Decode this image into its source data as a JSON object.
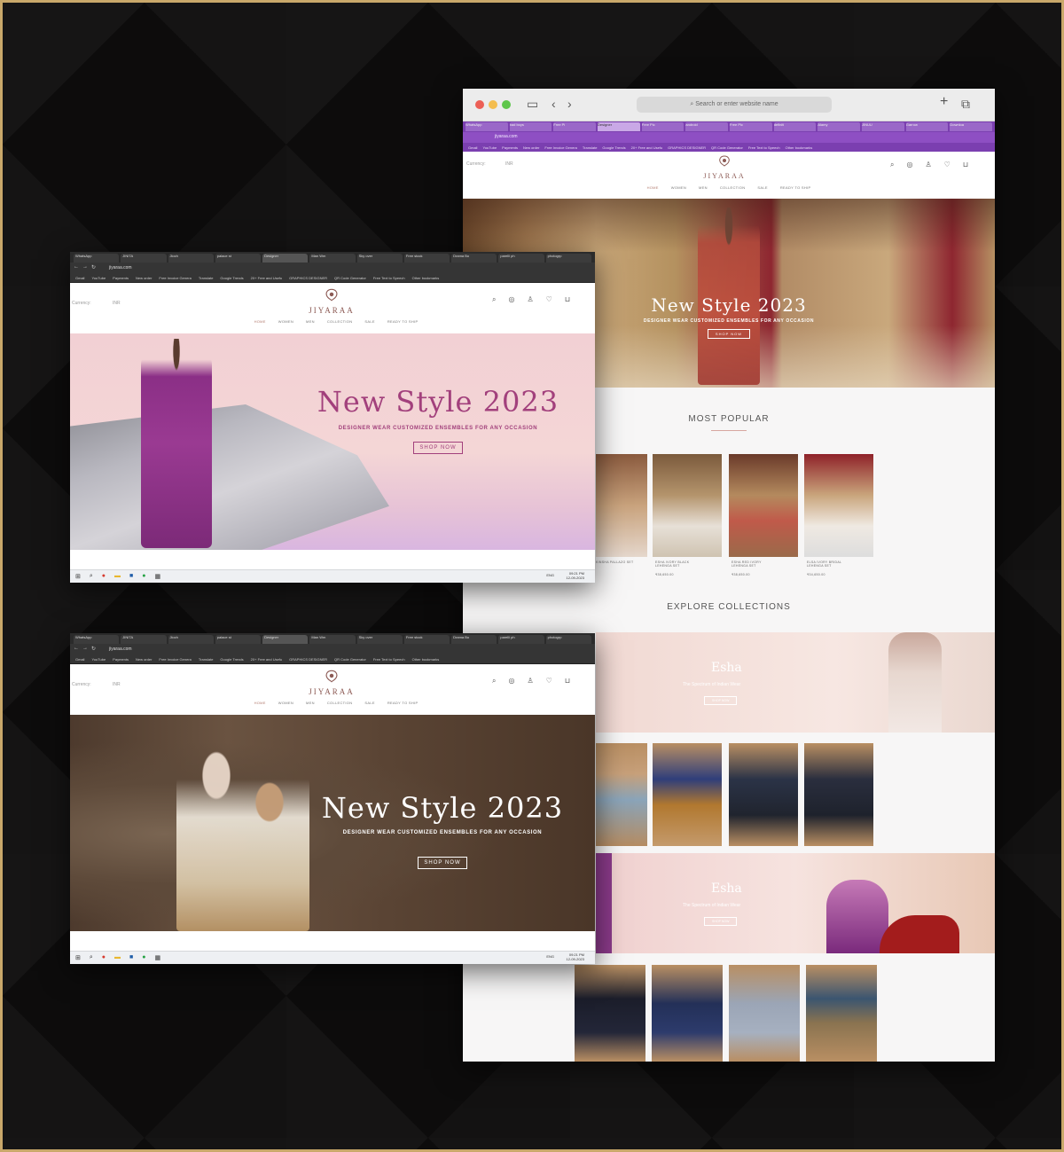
{
  "site": {
    "brand": "JIYARAA",
    "url": "jiyaraa.com",
    "currency_label": "Currency:",
    "currency_value": "INR",
    "nav": [
      "HOME",
      "WOMEN",
      "MEN",
      "COLLECTION",
      "SALE",
      "READY TO SHIP"
    ],
    "hero": {
      "title": "New Style 2023",
      "subtitle": "DESIGNER WEAR CUSTOMIZED ENSEMBLES FOR ANY OCCASION",
      "button": "SHOP NOW"
    },
    "sections": {
      "most_popular": "MOST POPULAR",
      "explore": "EXPLORE COLLECTIONS"
    },
    "products": [
      {
        "name": "KINSHA PALLAZO SET",
        "price": ""
      },
      {
        "name": "ESHA IVORY BLACK LEHENGA SET",
        "price": "₹38,650.00"
      },
      {
        "name": "ESHA RED IVORY LEHENGA SET",
        "price": "₹38,650.00"
      },
      {
        "name": "ELSA IVORY BRIDAL LEHENGA SET",
        "price": "₹34,650.00"
      }
    ],
    "collections": [
      {
        "title": "Esha",
        "subtitle": "The Spectrum of Indian Wear",
        "button": "SHOP NOW"
      },
      {
        "title": "Esha",
        "subtitle": "The Spectrum of Indian Wear",
        "button": "SHOP NOW"
      }
    ]
  },
  "mac_browser": {
    "search_placeholder": "Search or enter website name",
    "tabs": [
      "WhatsApp",
      "bad boys",
      "Free Pi",
      "Designer",
      "Free Pic",
      "android",
      "Free Pic",
      "definiti",
      "Alamy",
      "JINUU",
      "Garrow",
      "Downloa"
    ],
    "bookmarks": [
      "Gmail",
      "YouTube",
      "Payments",
      "New order",
      "Free Invoice Genera",
      "Translate",
      "Google Trends",
      "20+ Free and Usefu",
      "GRAPHICS DESIGNER",
      "QR Code Generator",
      "Free Text to Speech",
      "Other bookmarks"
    ]
  },
  "windows_browser_1": {
    "tabs": [
      "WhatsApp",
      "JINITA",
      "Jioch",
      "palace st",
      "Designer",
      "Man Wm",
      "Sky over",
      "Free stock",
      "Drama Bo",
      "parelli ph",
      "photogrp"
    ],
    "bookmarks": [
      "Gmail",
      "YouTube",
      "Payments",
      "New order",
      "Free Invoice Genera",
      "Translate",
      "Google Trends",
      "20+ Free and Usefu",
      "GRAPHICS DESIGNER",
      "QR Code Generator",
      "Free Text to Speech",
      "Other bookmarks"
    ],
    "clock_time": "09:21 PM",
    "clock_date": "12-09-2023",
    "lang": "ENG"
  },
  "windows_browser_2": {
    "tabs": [
      "WhatsApp",
      "JINITA",
      "Jioch",
      "palace st",
      "Designer",
      "Man Wm",
      "Sky over",
      "Free stock",
      "Drama Bo",
      "parelli ph",
      "photogrp"
    ],
    "bookmarks": [
      "Gmail",
      "YouTube",
      "Payments",
      "New order",
      "Free Invoice Genera",
      "Translate",
      "Google Trends",
      "20+ Free and Usefu",
      "GRAPHICS DESIGNER",
      "QR Code Generator",
      "Free Text to Speech",
      "Other bookmarks"
    ],
    "clock_time": "09:21 PM",
    "clock_date": "12-09-2023",
    "lang": "ENG"
  },
  "colors": {
    "frame_border": "#c9a86a",
    "accent_rose": "#b27a6e",
    "hero_pink_title": "#a2407c",
    "mac_purple": "#7b3fb0"
  }
}
